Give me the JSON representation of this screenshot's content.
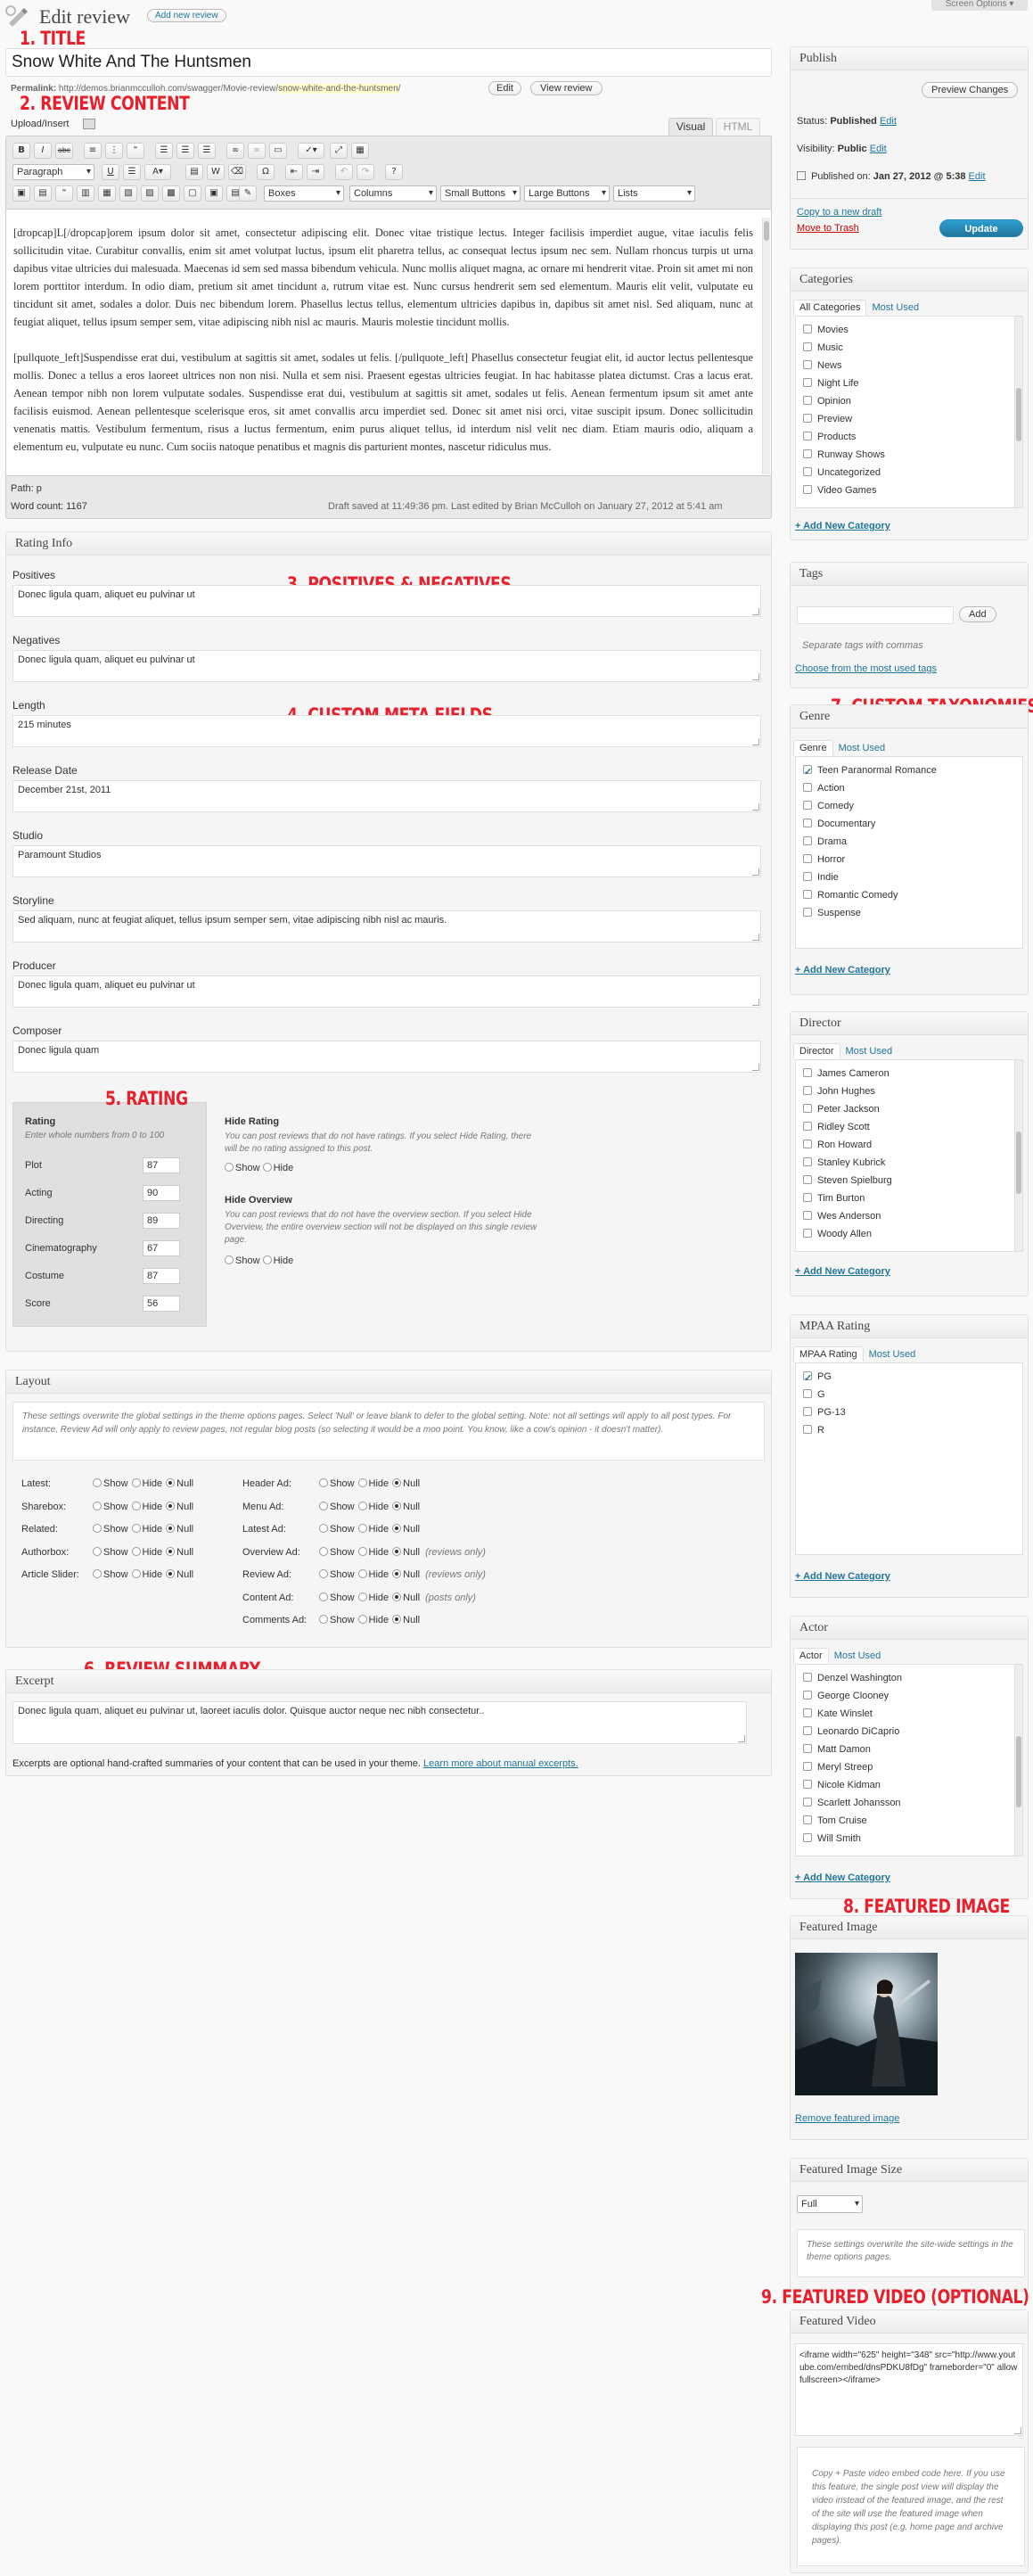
{
  "annotations": [
    "1. TITLE",
    "2. REVIEW CONTENT",
    "3. POSITIVES & NEGATIVES",
    "4. CUSTOM META FIELDS",
    "5. RATING",
    "6. REVIEW SUMMARY",
    "7. CUSTOM TAXONOMIES",
    "8. FEATURED IMAGE",
    "9. FEATURED VIDEO (OPTIONAL)"
  ],
  "header": {
    "title": "Edit review",
    "add_new": "Add new review",
    "screen_options": "Screen Options ▾"
  },
  "post": {
    "title": "Snow White And The Huntsmen",
    "permalink_label": "Permalink:",
    "permalink_base": "http://demos.brianmcculloh.com/swagger/Movie-review/",
    "permalink_slug": "snow-white-and-the-huntsmen",
    "permalink_end": "/",
    "edit_btn": "Edit",
    "view_btn": "View review"
  },
  "editor": {
    "upload_label": "Upload/Insert",
    "tab_visual": "Visual",
    "tab_html": "HTML",
    "format_select": "Paragraph",
    "boxes_select": "Boxes",
    "columns_select": "Columns",
    "small_buttons": "Small Buttons",
    "large_buttons": "Large Buttons",
    "lists_select": "Lists",
    "para1": "[dropcap]L[/dropcap]orem ipsum dolor sit amet, consectetur adipiscing elit. Donec vitae tristique lectus. Integer facilisis imperdiet augue, vitae iaculis felis sollicitudin vitae. Curabitur convallis, enim sit amet volutpat luctus, ipsum elit pharetra tellus, ac consequat lectus ipsum nec sem. Nullam rhoncus turpis ut urna dapibus vitae ultricies dui malesuada. Maecenas id sem sed massa bibendum vehicula. Nunc mollis aliquet magna, ac ornare mi hendrerit vitae. Proin sit amet mi non lorem porttitor interdum. In odio diam, pretium sit amet tincidunt a, rutrum vitae est. Nunc cursus hendrerit sem sed elementum. Mauris elit velit, vulputate eu tincidunt sit amet, sodales a dolor. Duis nec bibendum lorem. Phasellus lectus tellus, elementum ultricies dapibus in, dapibus sit amet nisl. Sed aliquam, nunc at feugiat aliquet, tellus ipsum semper sem, vitae adipiscing nibh nisl ac mauris. Mauris molestie tincidunt mollis.",
    "para2": "[pullquote_left]Suspendisse erat dui, vestibulum at sagittis sit amet, sodales ut felis. [/pullquote_left] Phasellus consectetur feugiat elit, id auctor lectus pellentesque mollis. Donec a tellus a eros laoreet ultrices non non nisi. Nulla et sem nisi. Praesent egestas ultricies feugiat. In hac habitasse platea dictumst. Cras a lacus erat. Aenean tempor nibh non lorem vulputate sodales. Suspendisse erat dui, vestibulum at sagittis sit amet, sodales ut felis. Aenean fermentum ipsum sit amet ante facilisis euismod. Aenean pellentesque scelerisque eros, sit amet convallis arcu imperdiet sed. Donec sit amet nisi orci, vitae suscipit ipsum. Donec sollicitudin venenatis mattis. Vestibulum fermentum, risus a luctus fermentum, enim purus aliquet tellus, id interdum nisl velit nec diam. Etiam mauris odio, aliquam a elementum eu, vulputate eu nunc. Cum sociis natoque penatibus et magnis dis parturient montes, nascetur ridiculus mus.",
    "path": "Path: p",
    "word_count": "Word count: 1167",
    "draft_saved": "Draft saved at 11:49:36 pm. Last edited by Brian McCulloh on January 27, 2012 at 5:41 am"
  },
  "rating_info": {
    "title": "Rating Info",
    "fields": [
      {
        "label": "Positives",
        "value": "Donec ligula quam, aliquet eu pulvinar ut"
      },
      {
        "label": "Negatives",
        "value": "Donec ligula quam, aliquet eu pulvinar ut"
      },
      {
        "label": "Length",
        "value": "215 minutes"
      },
      {
        "label": "Release Date",
        "value": "December 21st, 2011"
      },
      {
        "label": "Studio",
        "value": "Paramount Studios"
      },
      {
        "label": "Storyline",
        "value": "Sed aliquam, nunc at feugiat aliquet, tellus ipsum semper sem, vitae adipiscing nibh nisl ac mauris."
      },
      {
        "label": "Producer",
        "value": "Donec ligula quam, aliquet eu pulvinar ut"
      },
      {
        "label": "Composer",
        "value": "Donec ligula quam"
      }
    ],
    "rating_title": "Rating",
    "rating_hint": "Enter whole numbers from 0 to 100",
    "ratings": [
      {
        "label": "Plot",
        "value": "87"
      },
      {
        "label": "Acting",
        "value": "90"
      },
      {
        "label": "Directing",
        "value": "89"
      },
      {
        "label": "Cinematography",
        "value": "67"
      },
      {
        "label": "Costume",
        "value": "87"
      },
      {
        "label": "Score",
        "value": "56"
      }
    ],
    "hide_rating_title": "Hide Rating",
    "hide_rating_desc": "You can post reviews that do not have ratings. If you select Hide Rating, there will be no rating assigned to this post.",
    "hide_overview_title": "Hide Overview",
    "hide_overview_desc": "You can post reviews that do not have the overview section. If you select Hide Overview, the entire overview section will not be displayed on this single review page.",
    "show": "Show",
    "hide": "Hide"
  },
  "layout": {
    "title": "Layout",
    "desc": "These settings overwrite the global settings in the theme options pages. Select 'Null' or leave blank to defer to the global setting. Note: not all settings will apply to all post types. For instance, Review Ad will only apply to review pages, not regular blog posts (so selecting it would be a moo point. You know, like a cow's opinion - it doesn't matter).",
    "show": "Show",
    "hide": "Hide",
    "null": "Null",
    "left": [
      "Latest:",
      "Sharebox:",
      "Related:",
      "Authorbox:",
      "Article Slider:"
    ],
    "right": [
      "Header Ad:",
      "Menu Ad:",
      "Latest Ad:",
      "Overview Ad:",
      "Review Ad:",
      "Content Ad:",
      "Comments Ad:"
    ],
    "reviews_only": "(reviews only)",
    "posts_only": "(posts only)"
  },
  "excerpt": {
    "title": "Excerpt",
    "value": "Donec ligula quam, aliquet eu pulvinar ut, laoreet iaculis dolor. Quisque auctor neque nec nibh consectetur..",
    "help": "Excerpts are optional hand-crafted summaries of your content that can be used in your theme.",
    "learn_more": "Learn more about manual excerpts."
  },
  "publish": {
    "title": "Publish",
    "preview": "Preview Changes",
    "status_label": "Status:",
    "status": "Published",
    "visibility_label": "Visibility:",
    "visibility": "Public",
    "published_label": "Published on:",
    "published_on": "Jan 27, 2012 @ 5:38",
    "edit": "Edit",
    "copy_draft": "Copy to a new draft",
    "trash": "Move to Trash",
    "update": "Update"
  },
  "categories": {
    "title": "Categories",
    "tab_all": "All Categories",
    "tab_used": "Most Used",
    "items": [
      "Movies",
      "Music",
      "News",
      "Night Life",
      "Opinion",
      "Preview",
      "Products",
      "Runway Shows",
      "Uncategorized",
      "Video Games"
    ],
    "add": "+ Add New Category"
  },
  "tags": {
    "title": "Tags",
    "add": "Add",
    "hint": "Separate tags with commas",
    "choose": "Choose from the most used tags"
  },
  "genre": {
    "title": "Genre",
    "tab_all": "Genre",
    "tab_used": "Most Used",
    "items": [
      "Teen Paranormal Romance",
      "Action",
      "Comedy",
      "Documentary",
      "Drama",
      "Horror",
      "Indie",
      "Romantic Comedy",
      "Suspense"
    ],
    "add": "+ Add New Category"
  },
  "director": {
    "title": "Director",
    "tab_all": "Director",
    "tab_used": "Most Used",
    "items": [
      "James Cameron",
      "John Hughes",
      "Peter Jackson",
      "Ridley Scott",
      "Ron Howard",
      "Stanley Kubrick",
      "Steven Spielburg",
      "Tim Burton",
      "Wes Anderson",
      "Woody Allen"
    ],
    "add": "+ Add New Category"
  },
  "mpaa": {
    "title": "MPAA Rating",
    "tab_all": "MPAA Rating",
    "tab_used": "Most Used",
    "items": [
      "PG",
      "G",
      "PG-13",
      "R"
    ],
    "add": "+ Add New Category"
  },
  "actor": {
    "title": "Actor",
    "tab_all": "Actor",
    "tab_used": "Most Used",
    "items": [
      "Denzel Washington",
      "George Clooney",
      "Kate Winslet",
      "Leonardo DiCaprio",
      "Matt Damon",
      "Meryl Streep",
      "Nicole Kidman",
      "Scarlett Johansson",
      "Tom Cruise",
      "Will Smith"
    ],
    "add": "+ Add New Category"
  },
  "featured_image": {
    "title": "Featured Image",
    "remove": "Remove featured image"
  },
  "image_size": {
    "title": "Featured Image Size",
    "value": "Full",
    "desc": "These settings overwrite the site-wide settings in the theme options pages."
  },
  "featured_video": {
    "title": "Featured Video",
    "code": "<iframe width=\"625\" height=\"348\" src=\"http://www.youtube.com/embed/dnsPDKU8fDg\" frameborder=\"0\" allowfullscreen></iframe>",
    "desc": "Copy + Paste video embed code here. If you use this feature, the single post view will display the video instead of the featured image, and the rest of the site will use the featured image when displaying this post (e.g. home page and archive pages)."
  }
}
